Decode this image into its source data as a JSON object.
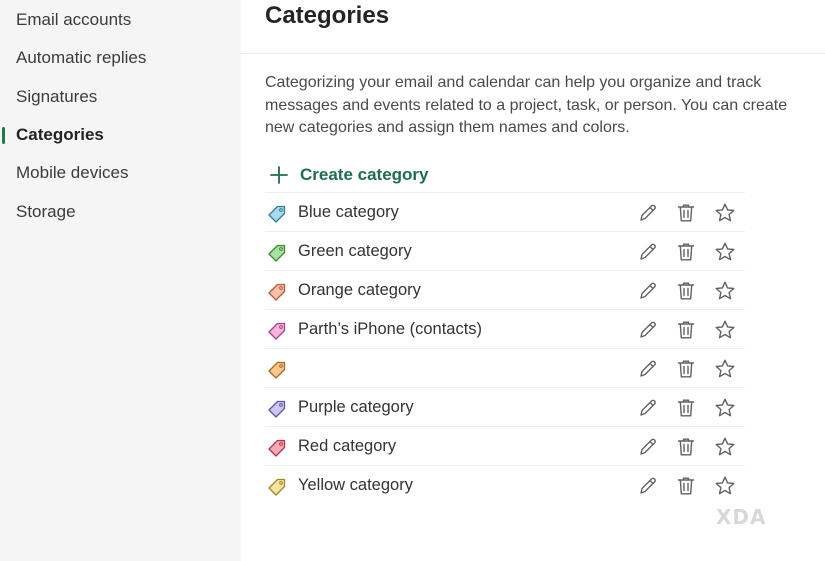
{
  "sidebar": {
    "items": [
      {
        "label": "Email accounts"
      },
      {
        "label": "Automatic replies"
      },
      {
        "label": "Signatures"
      },
      {
        "label": "Categories"
      },
      {
        "label": "Mobile devices"
      },
      {
        "label": "Storage"
      }
    ],
    "active": "Categories"
  },
  "main": {
    "title": "Categories",
    "description": "Categorizing your email and calendar can help you organize and track messages and events related to a project, task, or person. You can create new categories and assign them names and colors.",
    "create_label": "Create category",
    "categories": [
      {
        "name": "Blue category",
        "fill": "#a8dced",
        "stroke": "#2e7d98"
      },
      {
        "name": "Green category",
        "fill": "#a7e3a1",
        "stroke": "#3b8a35"
      },
      {
        "name": "Orange category",
        "fill": "#f7c1ab",
        "stroke": "#b8593a"
      },
      {
        "name": "Parth’s iPhone (contacts)",
        "fill": "#f3b7dc",
        "stroke": "#a8437f"
      },
      {
        "name": "",
        "fill": "#f7c98a",
        "stroke": "#a86a1e"
      },
      {
        "name": "Purple category",
        "fill": "#cfc6f2",
        "stroke": "#6453a8"
      },
      {
        "name": "Red category",
        "fill": "#f5a9b3",
        "stroke": "#b43244"
      },
      {
        "name": "Yellow category",
        "fill": "#f7e3a0",
        "stroke": "#a4862a"
      }
    ]
  },
  "icons": {
    "create": "plus-icon",
    "tag": "tag-icon",
    "edit": "pencil-icon",
    "delete": "trash-icon",
    "favorite": "star-icon"
  },
  "colors": {
    "accent": "#1f6e4b",
    "sidebar_bg": "#f5f5f5"
  },
  "watermark": "XDA"
}
